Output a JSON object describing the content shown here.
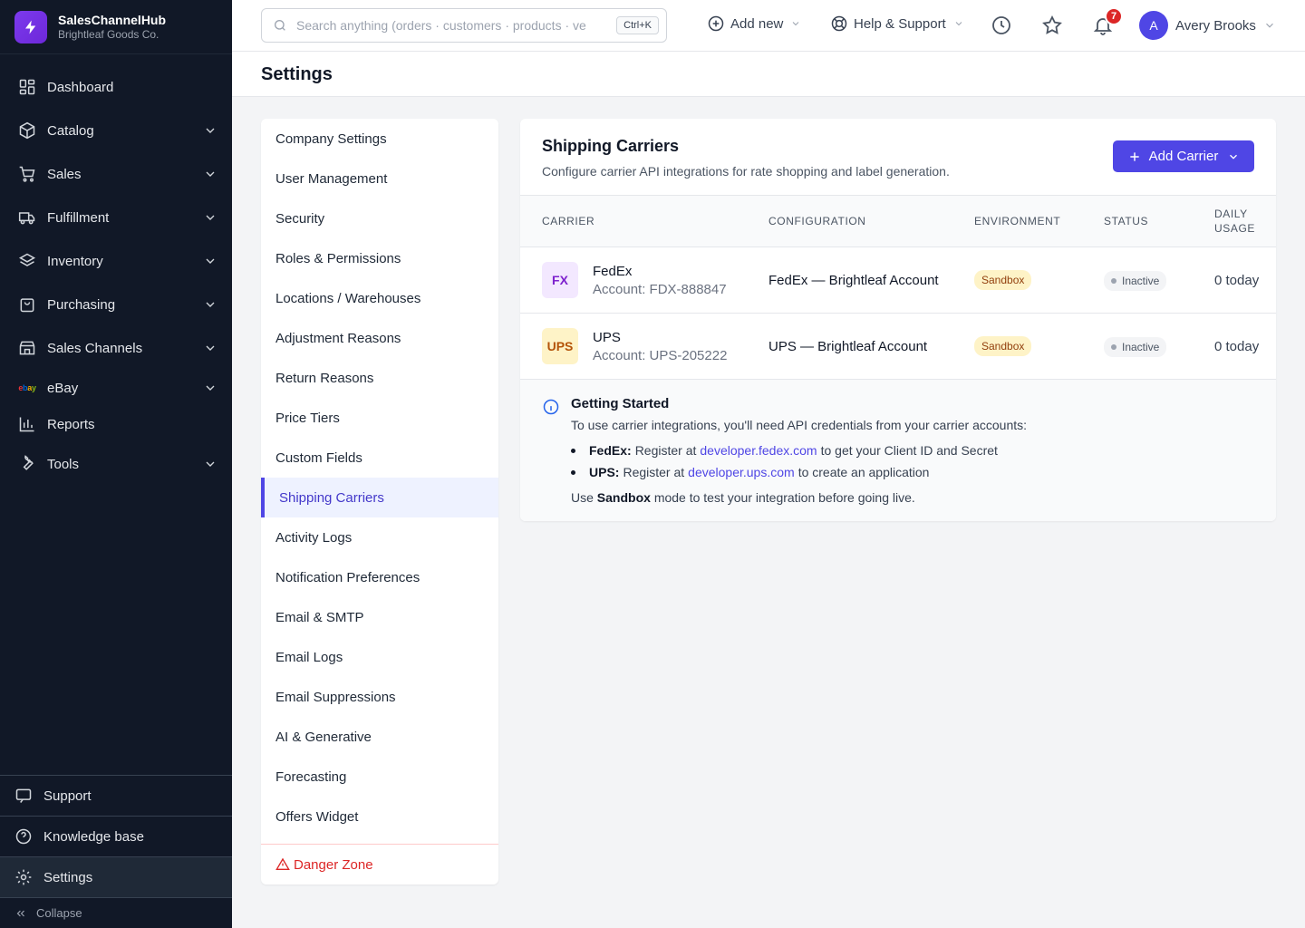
{
  "brand": {
    "name": "SalesChannelHub",
    "company": "Brightleaf Goods Co."
  },
  "sidebar": {
    "items": [
      {
        "label": "Dashboard"
      },
      {
        "label": "Catalog"
      },
      {
        "label": "Sales"
      },
      {
        "label": "Fulfillment"
      },
      {
        "label": "Inventory"
      },
      {
        "label": "Purchasing"
      },
      {
        "label": "Sales Channels"
      },
      {
        "label": "eBay"
      },
      {
        "label": "Reports"
      },
      {
        "label": "Tools"
      }
    ],
    "bottom": [
      {
        "label": "Support"
      },
      {
        "label": "Knowledge base"
      },
      {
        "label": "Settings"
      }
    ],
    "collapse_label": "Collapse"
  },
  "topbar": {
    "search_placeholder": "Search anything (orders · customers · products · ve",
    "search_shortcut": "Ctrl+K",
    "add_new": "Add new",
    "help": "Help & Support",
    "notification_count": "7",
    "user_initial": "A",
    "user_name": "Avery Brooks"
  },
  "page": {
    "title": "Settings"
  },
  "settings_menu": {
    "items": [
      {
        "label": "Company Settings"
      },
      {
        "label": "User Management"
      },
      {
        "label": "Security"
      },
      {
        "label": "Roles & Permissions"
      },
      {
        "label": "Locations / Warehouses"
      },
      {
        "label": "Adjustment Reasons"
      },
      {
        "label": "Return Reasons"
      },
      {
        "label": "Price Tiers"
      },
      {
        "label": "Custom Fields"
      },
      {
        "label": "Shipping Carriers"
      },
      {
        "label": "Activity Logs"
      },
      {
        "label": "Notification Preferences"
      },
      {
        "label": "Email & SMTP"
      },
      {
        "label": "Email Logs"
      },
      {
        "label": "Email Suppressions"
      },
      {
        "label": "AI & Generative"
      },
      {
        "label": "Forecasting"
      },
      {
        "label": "Offers Widget"
      }
    ],
    "active": "Shipping Carriers",
    "danger_label": "Danger Zone"
  },
  "carriers": {
    "title": "Shipping Carriers",
    "subtitle": "Configure carrier API integrations for rate shopping and label generation.",
    "add_button": "Add Carrier",
    "columns": {
      "carrier": "CARRIER",
      "configuration": "CONFIGURATION",
      "environment": "ENVIRONMENT",
      "status": "STATUS",
      "daily_usage_1": "DAILY",
      "daily_usage_2": "USAGE"
    },
    "rows": [
      {
        "logo": "FX",
        "name": "FedEx",
        "account": "Account: FDX-888847",
        "configuration": "FedEx — Brightleaf Account",
        "environment": "Sandbox",
        "status": "Inactive",
        "usage": "0 today",
        "logo_bg": "#f3e8ff",
        "logo_color": "#7e22ce"
      },
      {
        "logo": "UPS",
        "name": "UPS",
        "account": "Account: UPS-205222",
        "configuration": "UPS — Brightleaf Account",
        "environment": "Sandbox",
        "status": "Inactive",
        "usage": "0 today",
        "logo_bg": "#fef3c7",
        "logo_color": "#b45309"
      }
    ],
    "info": {
      "title": "Getting Started",
      "text": "To use carrier integrations, you'll need API credentials from your carrier accounts:",
      "fedex_label": "FedEx:",
      "fedex_pre": "Register at",
      "fedex_link": "developer.fedex.com",
      "fedex_post": "to get your Client ID and Secret",
      "ups_label": "UPS:",
      "ups_pre": "Register at",
      "ups_link": "developer.ups.com",
      "ups_post": "to create an application",
      "foot_pre": "Use",
      "foot_bold": "Sandbox",
      "foot_post": "mode to test your integration before going live."
    }
  },
  "colors": {
    "accent": "#4f46e5",
    "sidebar_bg": "#111827",
    "danger": "#dc2626"
  }
}
